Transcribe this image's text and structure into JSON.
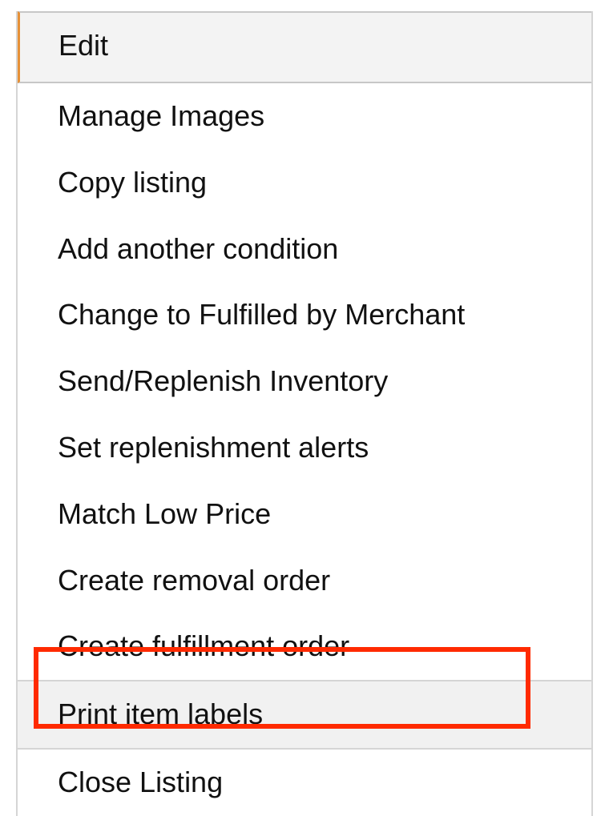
{
  "menu": {
    "header": "Edit",
    "items": [
      {
        "label": "Manage Images",
        "highlighted": false
      },
      {
        "label": "Copy listing",
        "highlighted": false
      },
      {
        "label": "Add another condition",
        "highlighted": false
      },
      {
        "label": "Change to Fulfilled by Merchant",
        "highlighted": false
      },
      {
        "label": "Send/Replenish Inventory",
        "highlighted": false
      },
      {
        "label": "Set replenishment alerts",
        "highlighted": false
      },
      {
        "label": "Match Low Price",
        "highlighted": false
      },
      {
        "label": "Create removal order",
        "highlighted": false
      },
      {
        "label": "Create fulfillment order",
        "highlighted": false
      },
      {
        "label": "Print item labels",
        "highlighted": true
      },
      {
        "label": "Close Listing",
        "highlighted": false
      }
    ]
  }
}
